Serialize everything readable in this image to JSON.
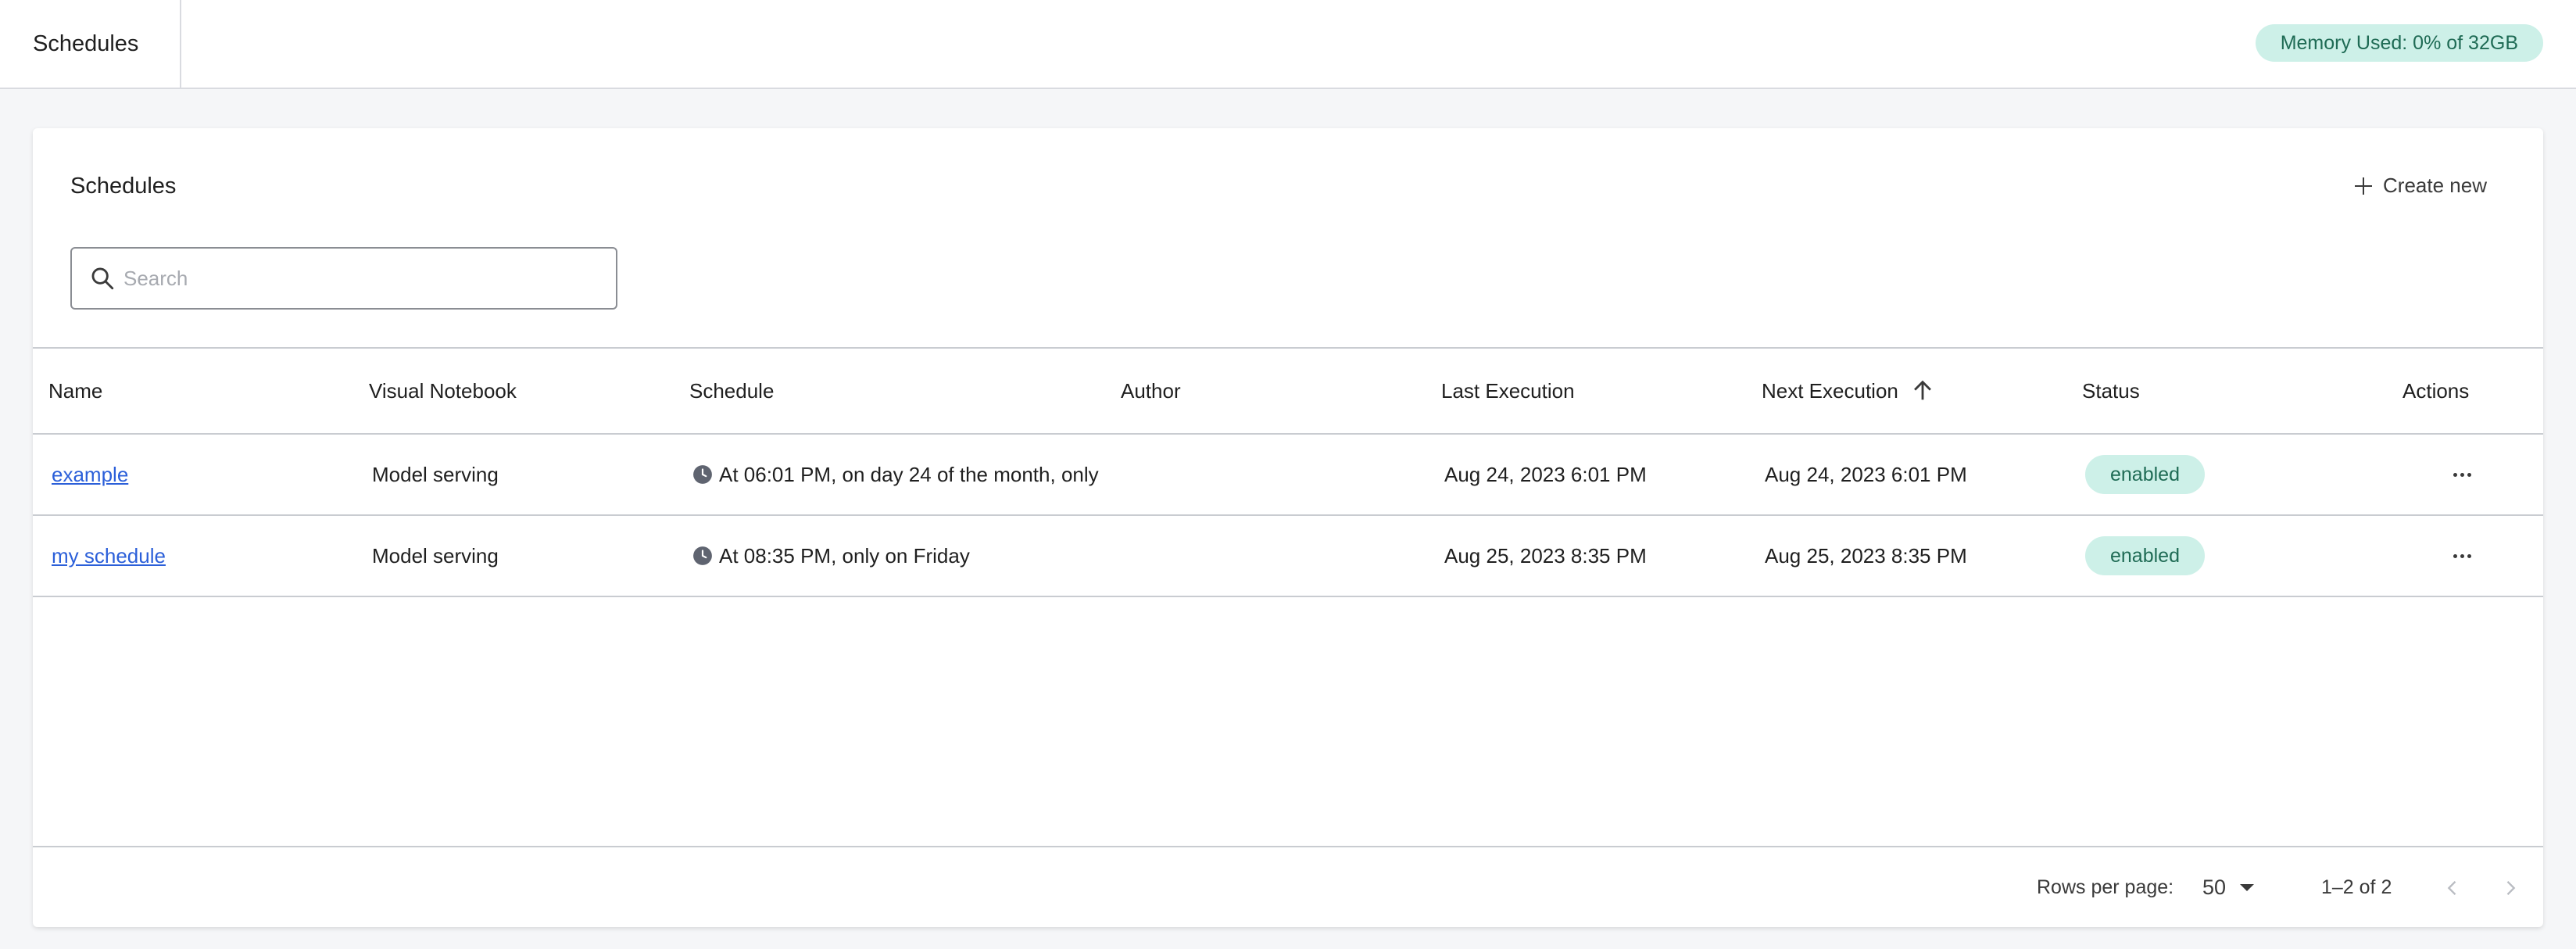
{
  "topbar": {
    "tab_label": "Schedules",
    "memory_badge": "Memory Used: 0% of 32GB"
  },
  "card": {
    "title": "Schedules",
    "create_new_label": "Create new",
    "search": {
      "placeholder": "Search",
      "value": ""
    }
  },
  "table": {
    "columns": {
      "name": "Name",
      "visual_notebook": "Visual Notebook",
      "schedule": "Schedule",
      "author": "Author",
      "last_execution": "Last Execution",
      "next_execution": "Next Execution",
      "status": "Status",
      "actions": "Actions"
    },
    "rows": [
      {
        "name": "example",
        "visual_notebook": "Model serving",
        "schedule": "At 06:01 PM, on day 24 of the month, only",
        "author": "",
        "last_execution": "Aug 24, 2023 6:01 PM",
        "next_execution": "Aug 24, 2023 6:01 PM",
        "status": "enabled"
      },
      {
        "name": "my schedule",
        "visual_notebook": "Model serving",
        "schedule": "At 08:35 PM, only on Friday",
        "author": "",
        "last_execution": "Aug 25, 2023 8:35 PM",
        "next_execution": "Aug 25, 2023 8:35 PM",
        "status": "enabled"
      }
    ]
  },
  "pagination": {
    "rows_per_page_label": "Rows per page:",
    "rows_per_page_value": "50",
    "range": "1–2 of 2"
  },
  "colors": {
    "accent_badge_bg": "#cdf0e8",
    "accent_badge_text": "#1f6b55",
    "link": "#2b5fd9"
  },
  "icons": [
    "search-icon",
    "plus-icon",
    "clock-icon",
    "arrow-up-icon",
    "more-horizontal-icon",
    "chevron-left-icon",
    "chevron-right-icon",
    "caret-down-icon"
  ]
}
